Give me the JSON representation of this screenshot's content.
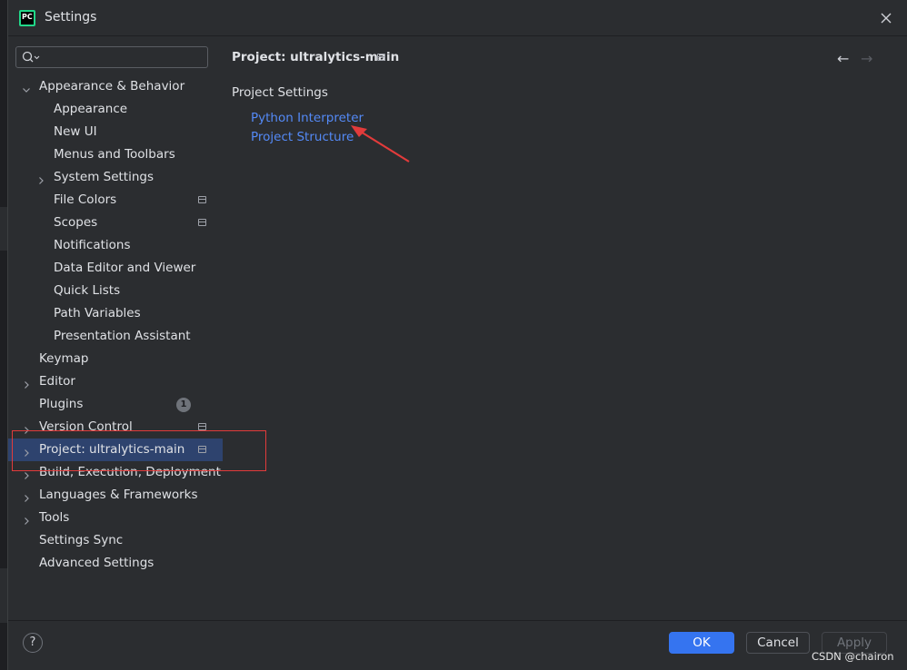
{
  "window": {
    "title": "Settings",
    "app_icon": "PC"
  },
  "search": {
    "placeholder": ""
  },
  "tree": [
    {
      "label": "Appearance & Behavior",
      "level": 0,
      "expanded": true
    },
    {
      "label": "Appearance",
      "level": 1
    },
    {
      "label": "New UI",
      "level": 1
    },
    {
      "label": "Menus and Toolbars",
      "level": 1
    },
    {
      "label": "System Settings",
      "level": 1,
      "collapsed": true
    },
    {
      "label": "File Colors",
      "level": 1,
      "project_icon": true
    },
    {
      "label": "Scopes",
      "level": 1,
      "project_icon": true
    },
    {
      "label": "Notifications",
      "level": 1
    },
    {
      "label": "Data Editor and Viewer",
      "level": 1
    },
    {
      "label": "Quick Lists",
      "level": 1
    },
    {
      "label": "Path Variables",
      "level": 1
    },
    {
      "label": "Presentation Assistant",
      "level": 1
    },
    {
      "label": "Keymap",
      "level": 0
    },
    {
      "label": "Editor",
      "level": 0,
      "collapsed": true
    },
    {
      "label": "Plugins",
      "level": 0,
      "badge": "1"
    },
    {
      "label": "Version Control",
      "level": 0,
      "collapsed": true,
      "project_icon": true
    },
    {
      "label": "Project: ultralytics-main",
      "level": 0,
      "collapsed": true,
      "project_icon": true,
      "selected": true
    },
    {
      "label": "Build, Execution, Deployment",
      "level": 0,
      "collapsed": true
    },
    {
      "label": "Languages & Frameworks",
      "level": 0,
      "collapsed": true
    },
    {
      "label": "Tools",
      "level": 0,
      "collapsed": true
    },
    {
      "label": "Settings Sync",
      "level": 0
    },
    {
      "label": "Advanced Settings",
      "level": 0
    }
  ],
  "main": {
    "breadcrumb": "Project: ultralytics-main",
    "section_title": "Project Settings",
    "links": [
      "Python Interpreter",
      "Project Structure"
    ]
  },
  "footer": {
    "help_label": "?",
    "ok_label": "OK",
    "cancel_label": "Cancel",
    "apply_label": "Apply"
  },
  "watermark": "CSDN @chairon",
  "colors": {
    "accent": "#3574f0",
    "link": "#548af7",
    "selection": "#2e436e",
    "annotation": "#e23b3b"
  }
}
